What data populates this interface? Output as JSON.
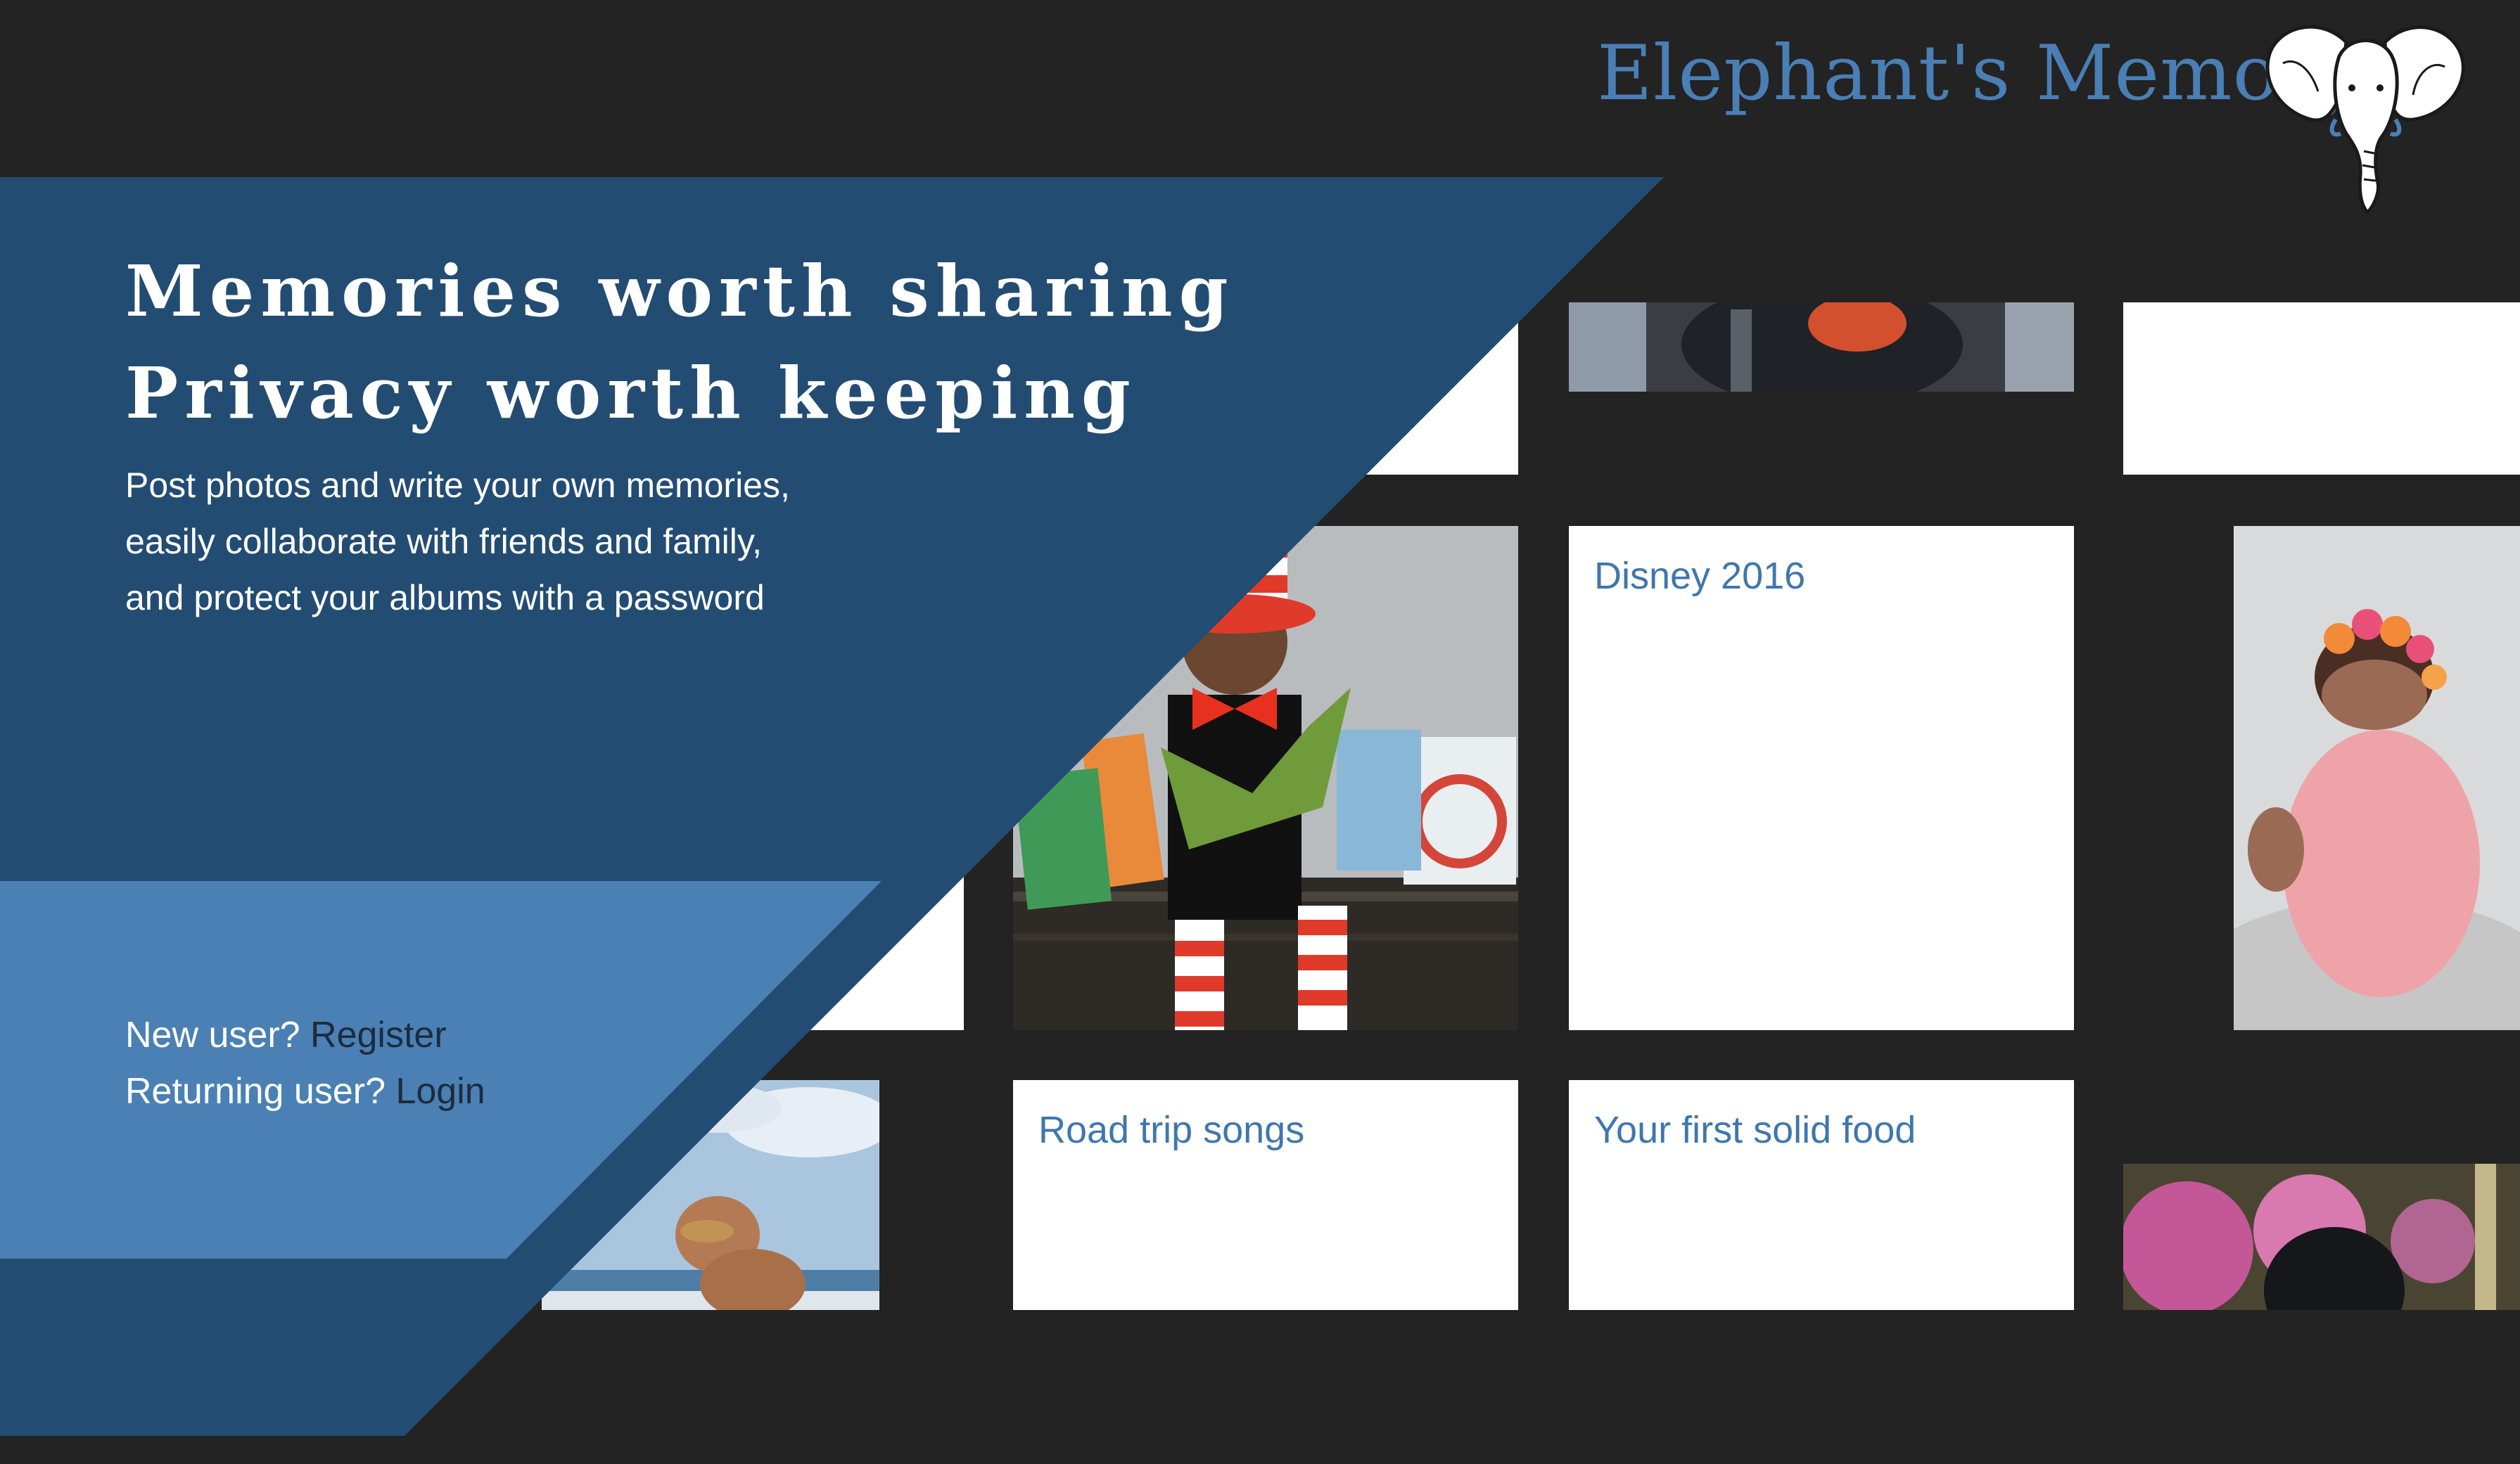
{
  "brand": {
    "name": "Elephant's Memory",
    "color": "#4a7fb5"
  },
  "hero": {
    "heading_line1": "Memories worth sharing",
    "heading_line2": "Privacy worth keeping",
    "description_lines": [
      "Post photos and write your own memories,",
      "easily collaborate with friends and family,",
      "and protect your albums with a password"
    ]
  },
  "auth": {
    "new_user_prompt": "New user?",
    "register_link": "Register",
    "returning_user_prompt": "Returning user?",
    "login_link": "Login"
  },
  "albums": [
    {
      "title": "Disney 2016"
    },
    {
      "title": "Road trip songs"
    },
    {
      "title": "Your first solid food"
    }
  ],
  "photos": [
    {
      "subject": "airplane-seat-photo"
    },
    {
      "subject": "child-reading-dr-seuss-photo"
    },
    {
      "subject": "sleeping-newborn-photo"
    },
    {
      "subject": "man-at-beach-photo"
    },
    {
      "subject": "pink-balloons-photo"
    }
  ],
  "colors": {
    "background": "#232323",
    "panel_dark": "#234c73",
    "panel_light": "#4a80b4",
    "album_title": "#3f77ad"
  }
}
